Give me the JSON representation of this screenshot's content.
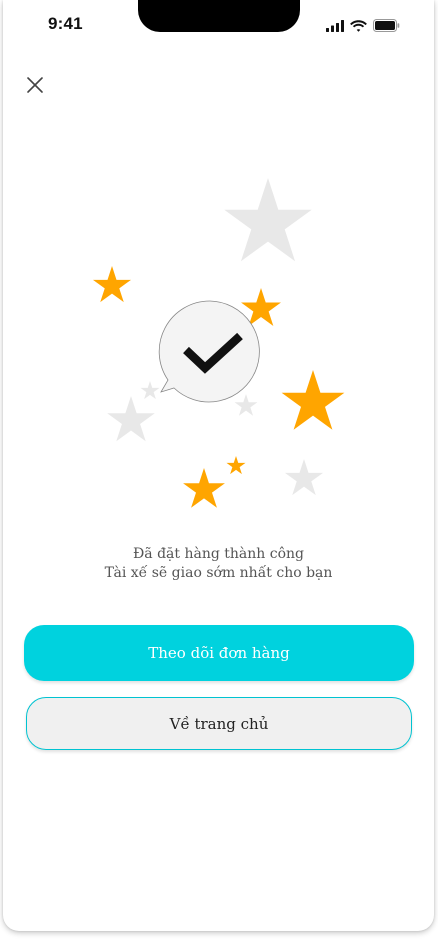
{
  "status_bar": {
    "time": "9:41",
    "icons": [
      "cellular-signal-icon",
      "wifi-icon",
      "battery-icon"
    ]
  },
  "header": {
    "close_icon": "close-icon"
  },
  "illustration": {
    "center_icon": "checkmark-icon",
    "colors": {
      "star_orange": "#FFA500",
      "star_gray": "#E8E8E8",
      "bubble_fill": "#F4F4F4",
      "check": "#111111"
    }
  },
  "message": {
    "line1": "Đã đặt hàng thành công",
    "line2": "Tài xế sẽ giao sớm nhất cho bạn"
  },
  "actions": {
    "track_order_label": "Theo dõi đơn hàng",
    "home_label": "Về trang chủ"
  },
  "colors": {
    "accent": "#00D2DE",
    "accent_border": "#00C3D1",
    "secondary_bg": "#F0F0F0"
  }
}
